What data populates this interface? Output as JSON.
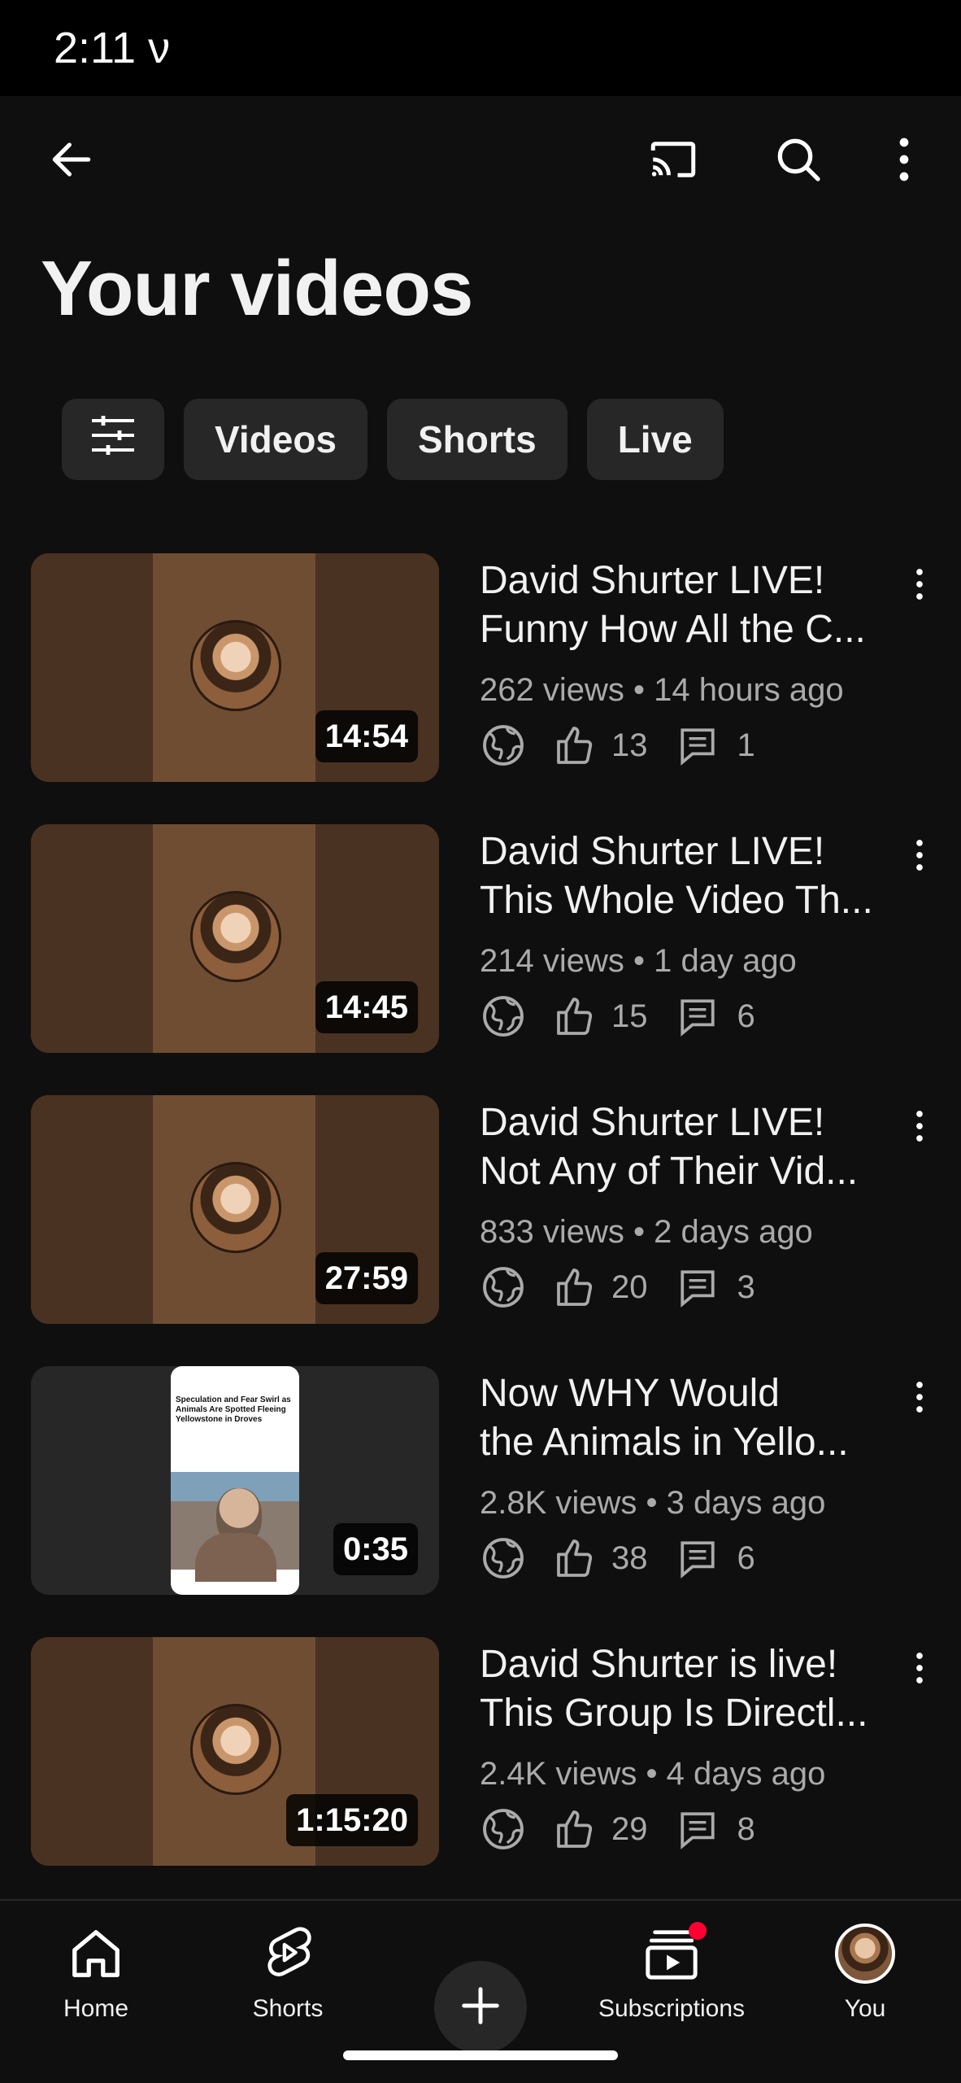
{
  "status_bar": {
    "time": "2:11",
    "extra": "ν"
  },
  "header": {
    "title": "Your videos",
    "icons": [
      "back-arrow-icon",
      "cast-icon",
      "search-icon",
      "more-vert-icon"
    ]
  },
  "filters": {
    "filter_icon": "tune-icon",
    "chips": [
      "Videos",
      "Shorts",
      "Live"
    ]
  },
  "videos": [
    {
      "title_line1": "David Shurter LIVE!",
      "title_line2": "Funny How All the C...",
      "duration": "14:54",
      "meta": "262 views • 14 hours ago",
      "likes": "13",
      "comments": "1",
      "thumb": "live"
    },
    {
      "title_line1": "David Shurter LIVE!",
      "title_line2": "This Whole Video Th...",
      "duration": "14:45",
      "meta": "214 views • 1 day ago",
      "likes": "15",
      "comments": "6",
      "thumb": "live"
    },
    {
      "title_line1": "David Shurter LIVE!",
      "title_line2": "Not Any of Their Vid...",
      "duration": "27:59",
      "meta": "833 views • 2 days ago",
      "likes": "20",
      "comments": "3",
      "thumb": "live"
    },
    {
      "title_line1": "Now WHY Would",
      "title_line2": "the Animals in Yello...",
      "duration": "0:35",
      "meta": "2.8K views • 3 days ago",
      "likes": "38",
      "comments": "6",
      "thumb": "short",
      "thumb_text": "Speculation and Fear Swirl as Animals Are Spotted Fleeing Yellowstone in Droves"
    },
    {
      "title_line1": "David Shurter is live!",
      "title_line2": "This Group Is Directl...",
      "duration": "1:15:20",
      "meta": "2.4K views • 4 days ago",
      "likes": "29",
      "comments": "8",
      "thumb": "live"
    }
  ],
  "bottom_nav": {
    "items": [
      {
        "label": "Home",
        "icon": "home-icon"
      },
      {
        "label": "Shorts",
        "icon": "shorts-icon"
      },
      {
        "label": "",
        "icon": "create-plus-icon"
      },
      {
        "label": "Subscriptions",
        "icon": "subscriptions-icon",
        "badge": true
      },
      {
        "label": "You",
        "icon": "you-avatar"
      }
    ]
  },
  "colors": {
    "background": "#0f0f0f",
    "chip": "#272727",
    "secondary_text": "#aaaaaa",
    "badge": "#ff0033"
  }
}
